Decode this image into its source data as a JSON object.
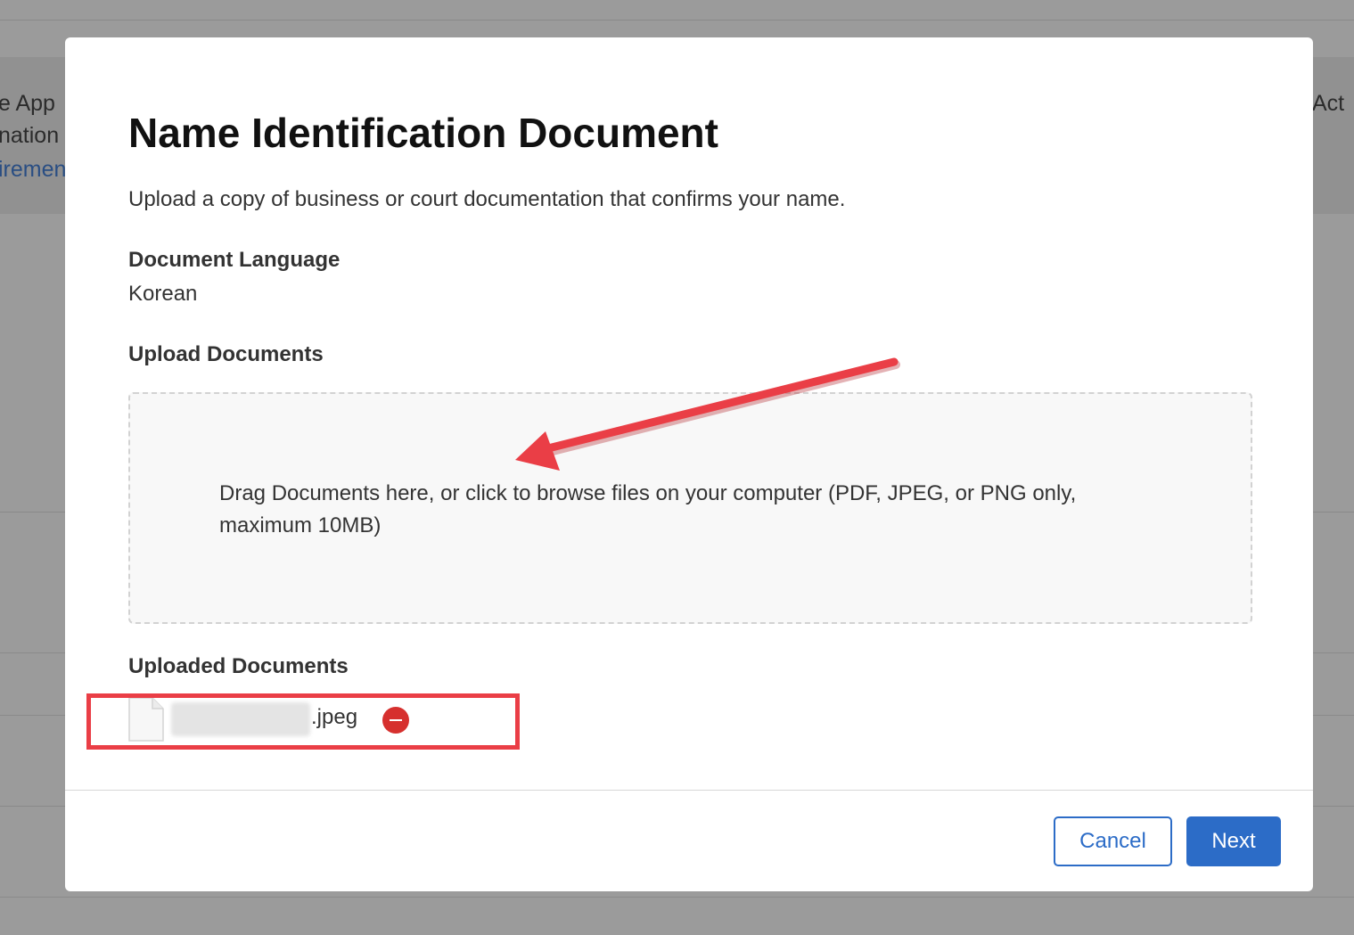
{
  "background": {
    "left_lines": [
      "e App",
      "nation",
      "iremen"
    ],
    "right_text": "Act"
  },
  "modal": {
    "title": "Name Identification Document",
    "subtitle": "Upload a copy of business or court documentation that confirms your name.",
    "document_language": {
      "label": "Document Language",
      "value": "Korean"
    },
    "upload": {
      "label": "Upload Documents",
      "dropzone_text": "Drag Documents here, or click to browse files on your computer (PDF, JPEG, or PNG only, maximum 10MB)"
    },
    "uploaded": {
      "label": "Uploaded Documents",
      "files": [
        {
          "extension": ".jpeg"
        }
      ]
    },
    "buttons": {
      "cancel": "Cancel",
      "next": "Next"
    }
  },
  "colors": {
    "primary": "#2c6cc7",
    "remove": "#d6302e",
    "annotation": "#ea3e46"
  },
  "icons": {
    "file": "file-icon",
    "remove": "remove-minus-icon"
  }
}
